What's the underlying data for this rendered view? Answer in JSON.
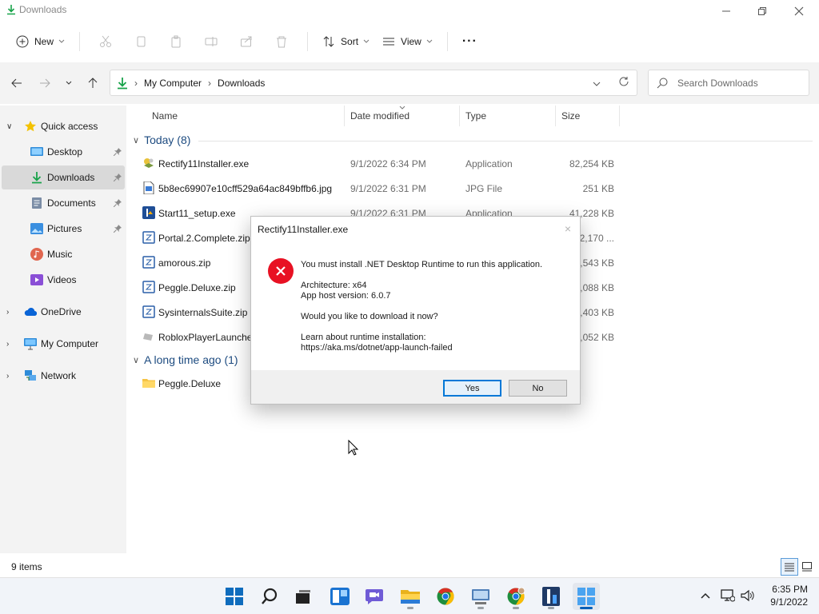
{
  "window": {
    "title": "Downloads"
  },
  "toolbar": {
    "new_label": "New",
    "sort_label": "Sort",
    "view_label": "View",
    "more_label": "···"
  },
  "address": {
    "crumbs": [
      "My Computer",
      "Downloads"
    ],
    "search_placeholder": "Search Downloads"
  },
  "sidebar": {
    "items": [
      {
        "label": "Quick access"
      },
      {
        "label": "Desktop"
      },
      {
        "label": "Downloads"
      },
      {
        "label": "Documents"
      },
      {
        "label": "Pictures"
      },
      {
        "label": "Music"
      },
      {
        "label": "Videos"
      },
      {
        "label": "OneDrive"
      },
      {
        "label": "My Computer"
      },
      {
        "label": "Network"
      }
    ]
  },
  "columns": {
    "name": "Name",
    "date": "Date modified",
    "type": "Type",
    "size": "Size"
  },
  "groups": [
    {
      "label": "Today (8)"
    },
    {
      "label": "A long time ago (1)"
    }
  ],
  "files": [
    {
      "name": "Rectify11Installer.exe",
      "date": "9/1/2022 6:34 PM",
      "type": "Application",
      "size": "82,254 KB"
    },
    {
      "name": "5b8ec69907e10cff529a64ac849bffb6.jpg",
      "date": "9/1/2022 6:31 PM",
      "type": "JPG File",
      "size": "251 KB"
    },
    {
      "name": "Start11_setup.exe",
      "date": "9/1/2022 6:31 PM",
      "type": "Application",
      "size": "41,228 KB"
    },
    {
      "name": "Portal.2.Complete.zip",
      "date": "",
      "type": "",
      "size": "32,170 ..."
    },
    {
      "name": "amorous.zip",
      "date": "",
      "type": "",
      "size": "2,543 KB"
    },
    {
      "name": "Peggle.Deluxe.zip",
      "date": "",
      "type": "",
      "size": "1,088 KB"
    },
    {
      "name": "SysinternalsSuite.zip",
      "date": "",
      "type": "",
      "size": "5,403 KB"
    },
    {
      "name": "RobloxPlayerLauncher",
      "date": "",
      "type": "",
      "size": "2,052 KB"
    },
    {
      "name": "Peggle.Deluxe",
      "date": "",
      "type": "",
      "size": ""
    }
  ],
  "status": {
    "count": "9 items"
  },
  "dialog": {
    "title": "Rectify11Installer.exe",
    "close": "×",
    "line1": "You must install .NET Desktop Runtime to run this application.",
    "line2": "Architecture: x64",
    "line3": "App host version: 6.0.7",
    "line4": "Would you like to download it now?",
    "line5": "Learn about runtime installation:",
    "line6": "https://aka.ms/dotnet/app-launch-failed",
    "yes": "Yes",
    "no": "No"
  },
  "clock": {
    "time": "6:35 PM",
    "date": "9/1/2022"
  },
  "colors": {
    "accent": "#005fb8",
    "error": "#e81123",
    "group": "#1d4b80"
  }
}
